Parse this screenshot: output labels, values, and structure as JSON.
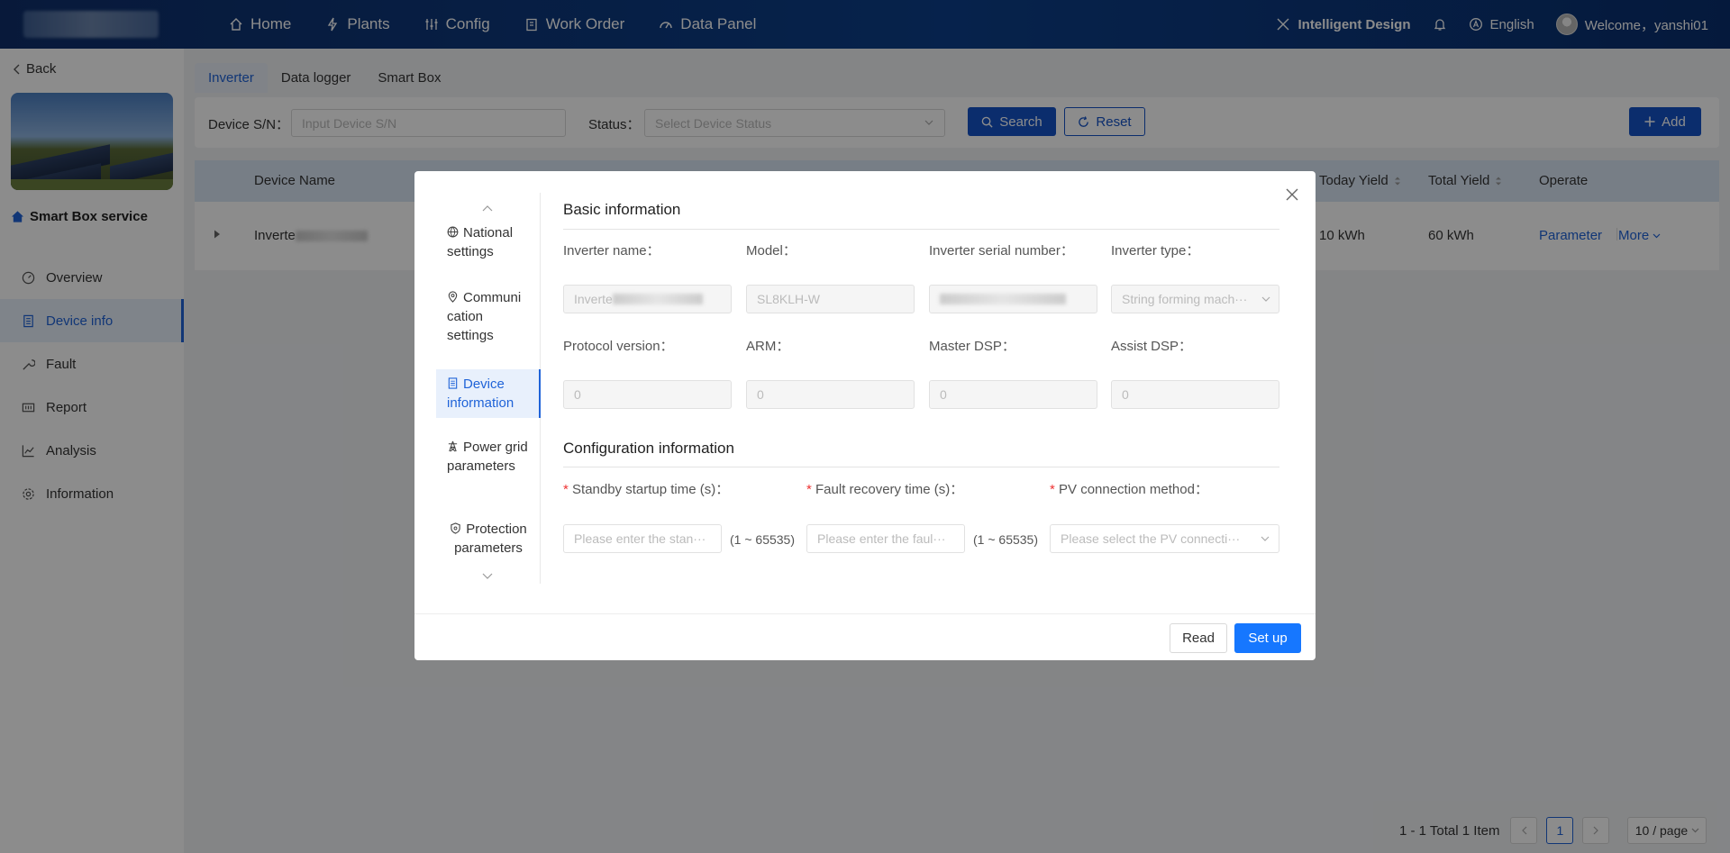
{
  "nav": {
    "items": [
      {
        "label": "Home",
        "icon": "home-icon"
      },
      {
        "label": "Plants",
        "icon": "bolt-icon"
      },
      {
        "label": "Config",
        "icon": "sliders-icon"
      },
      {
        "label": "Work Order",
        "icon": "clipboard-icon"
      },
      {
        "label": "Data Panel",
        "icon": "dashboard-icon"
      }
    ],
    "intelligent_design": "Intelligent Design",
    "language": "English",
    "welcome": "Welcome，yanshi01"
  },
  "sidebar": {
    "back": "Back",
    "plant_name": "Smart Box service",
    "items": [
      {
        "label": "Overview"
      },
      {
        "label": "Device info"
      },
      {
        "label": "Fault"
      },
      {
        "label": "Report"
      },
      {
        "label": "Analysis"
      },
      {
        "label": "Information"
      }
    ]
  },
  "tabs": [
    "Inverter",
    "Data logger",
    "Smart Box"
  ],
  "filter": {
    "sn_label": "Device S/N：",
    "sn_placeholder": "Input Device S/N",
    "status_label": "Status：",
    "status_placeholder": "Select Device Status",
    "search": "Search",
    "reset": "Reset",
    "add": "Add"
  },
  "table": {
    "headers": {
      "device_name": "Device Name",
      "today_yield": "Today Yield",
      "total_yield": "Total Yield",
      "operate": "Operate"
    },
    "row": {
      "device_name": "Inverte",
      "today_yield": "10 kWh",
      "total_yield": "60 kWh",
      "parameter": "Parameter",
      "more": "More"
    }
  },
  "pagination": {
    "summary": "1 - 1 Total 1 Item",
    "current": "1",
    "page_size": "10 / page"
  },
  "modal": {
    "nav": [
      {
        "label": "National settings",
        "icon": "globe-icon"
      },
      {
        "label": "Communi cation settings",
        "icon": "location-pin-icon"
      },
      {
        "label": "Device information",
        "icon": "document-icon"
      },
      {
        "label": "Power grid parameters",
        "icon": "tower-icon"
      },
      {
        "label": "Protection parameters",
        "icon": "shield-icon"
      }
    ],
    "basic_title": "Basic information",
    "labels": {
      "inverter_name": "Inverter name：",
      "model": "Model：",
      "serial": "Inverter serial number：",
      "type": "Inverter type：",
      "protocol": "Protocol version：",
      "arm": "ARM：",
      "master_dsp": "Master DSP：",
      "assist_dsp": "Assist DSP："
    },
    "values": {
      "inverter_name": "Inverte",
      "model": "SL8KLH-W",
      "type": "String forming mach···",
      "protocol": "0",
      "arm": "0",
      "master_dsp": "0",
      "assist_dsp": "0"
    },
    "config_title": "Configuration information",
    "config_labels": {
      "standby": "Standby startup time (s)：",
      "fault": "Fault recovery time (s)：",
      "pv": "PV connection method："
    },
    "config_placeholders": {
      "standby": "Please enter the stan···",
      "fault": "Please enter the faul···",
      "pv": "Please select the PV connecti···"
    },
    "range": "(1 ~ 65535)",
    "read": "Read",
    "setup": "Set up"
  }
}
